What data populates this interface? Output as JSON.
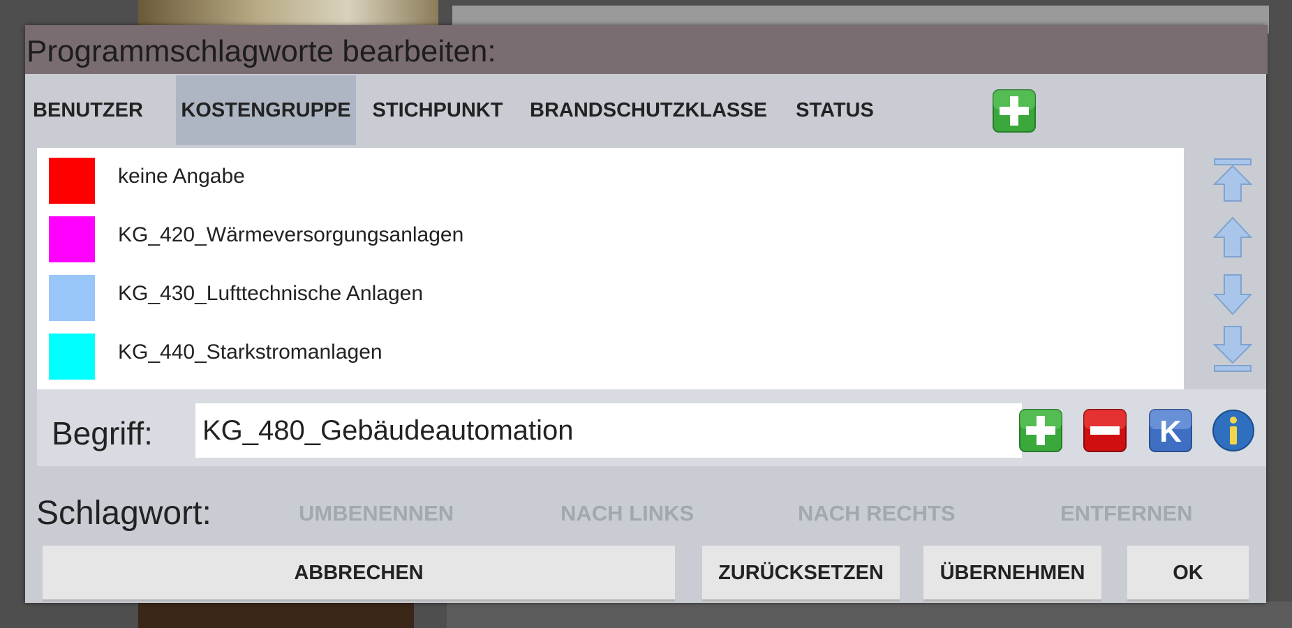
{
  "dialog": {
    "title": "Programmschlagworte bearbeiten:"
  },
  "tabs": [
    {
      "label": "BENUTZER",
      "active": false
    },
    {
      "label": "KOSTENGRUPPE",
      "active": true
    },
    {
      "label": "STICHPUNKT",
      "active": false
    },
    {
      "label": "BRANDSCHUTZKLASSE",
      "active": false
    },
    {
      "label": "STATUS",
      "active": false
    }
  ],
  "list": {
    "items": [
      {
        "label": "keine Angabe",
        "color": "#ff0000"
      },
      {
        "label": "KG_420_Wärmeversorgungsanlagen",
        "color": "#ff00ff"
      },
      {
        "label": "KG_430_Lufttechnische Anlagen",
        "color": "#99c6f8"
      },
      {
        "label": "KG_440_Starkstromanlagen",
        "color": "#00ffff"
      }
    ]
  },
  "begriff": {
    "label": "Begriff:",
    "value": "KG_480_Gebäudeautomation"
  },
  "schlagwort": {
    "label": "Schlagwort:",
    "actions": [
      "UMBENENNEN",
      "NACH LINKS",
      "NACH RECHTS",
      "ENTFERNEN"
    ]
  },
  "footer": {
    "cancel": "ABBRECHEN",
    "reset": "ZURÜCKSETZEN",
    "apply": "ÜBERNEHMEN",
    "ok": "OK"
  },
  "icons": {
    "add_tab": "plus-icon",
    "move_top": "arrow-top-icon",
    "move_up": "arrow-up-icon",
    "move_down": "arrow-down-icon",
    "move_bottom": "arrow-bottom-icon",
    "add_term": "plus-icon",
    "remove_term": "minus-icon",
    "k_button_letter": "K",
    "info": "info-icon"
  },
  "colors": {
    "title_bar": "#7a6d72",
    "active_tab": "#aeb6c4",
    "green": "#3aa83a",
    "red": "#d01010",
    "blue": "#3f6fc2"
  }
}
